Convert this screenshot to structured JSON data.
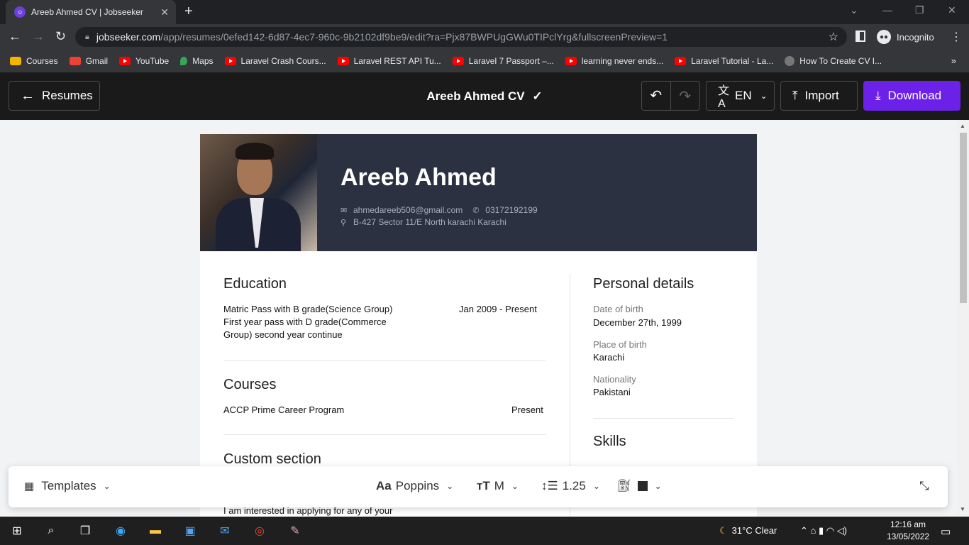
{
  "browser": {
    "tab_title": "Areeb Ahmed CV | Jobseeker",
    "url_host": "jobseeker.com",
    "url_path": "/app/resumes/0efed142-6d87-4ec7-960c-9b2102df9be9/edit?ra=Pjx87BWPUgGWu0TIPclYrg&fullscreenPreview=1",
    "profile_label": "Incognito",
    "bookmarks": [
      "Courses",
      "Gmail",
      "YouTube",
      "Maps",
      "Laravel Crash Cours...",
      "Laravel REST API Tu...",
      "Laravel 7 Passport –...",
      "learning never ends...",
      "Laravel Tutorial - La...",
      "How To Create CV I..."
    ]
  },
  "header": {
    "back_label": "Resumes",
    "doc_title": "Areeb Ahmed CV",
    "lang_label": "EN",
    "import_label": "Import",
    "download_label": "Download"
  },
  "cv": {
    "name": "Areeb Ahmed",
    "email": "ahmedareeb506@gmail.com",
    "phone": "03172192199",
    "address": "B-427 Sector 11/E North karachi Karachi",
    "education_heading": "Education",
    "education_text_1": "Matric Pass with B grade(Science Group)",
    "education_text_2": "First year pass with D grade(Commerce",
    "education_text_3": "Group) second year continue",
    "education_date": "Jan 2009 - Present",
    "courses_heading": "Courses",
    "course_name": "ACCP Prime Career Program",
    "course_date": "Present",
    "custom_heading": "Custom section",
    "custom_text": "I am interested in applying for any of your",
    "personal_heading": "Personal details",
    "dob_label": "Date of birth",
    "dob_value": "December 27th, 1999",
    "pob_label": "Place of birth",
    "pob_value": "Karachi",
    "nationality_label": "Nationality",
    "nationality_value": "Pakistani",
    "skills_heading": "Skills"
  },
  "bottom_bar": {
    "templates_label": "Templates",
    "font_label": "Poppins",
    "size_label": "M",
    "spacing_label": "1.25"
  },
  "taskbar": {
    "weather": "31°C  Clear",
    "time": "12:16 am",
    "date": "13/05/2022"
  }
}
